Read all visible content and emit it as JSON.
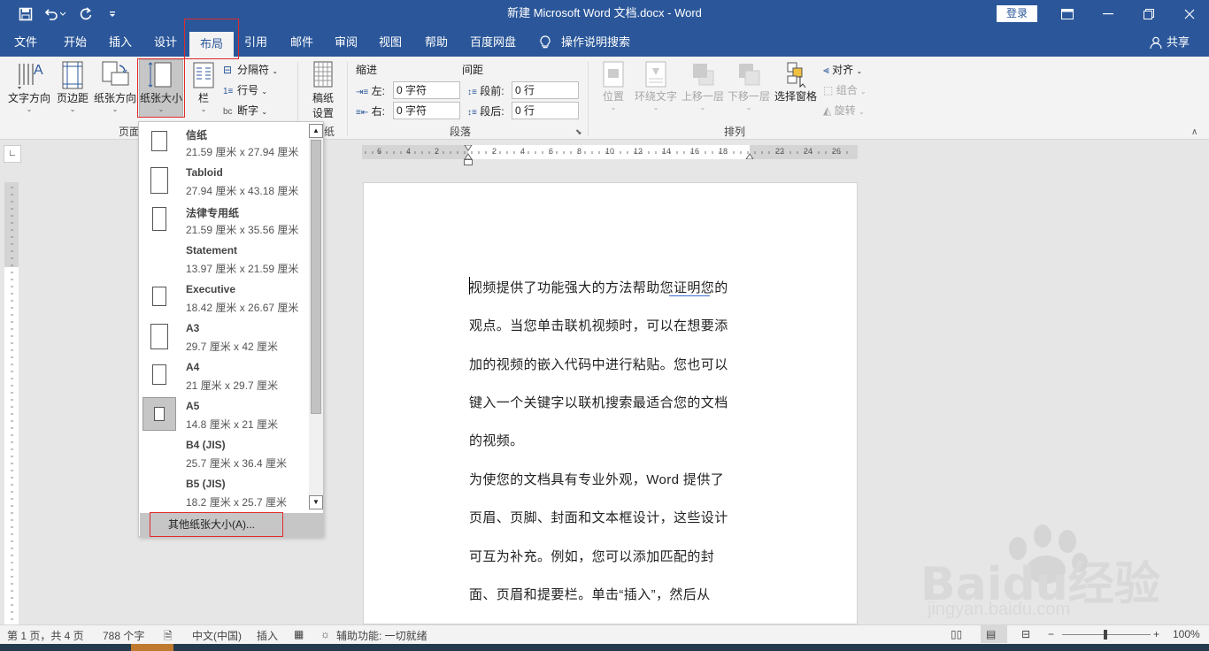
{
  "titlebar": {
    "title": "新建 Microsoft Word 文档.docx  -  Word",
    "login": "登录"
  },
  "tabs": [
    "文件",
    "开始",
    "插入",
    "设计",
    "布局",
    "引用",
    "邮件",
    "审阅",
    "视图",
    "帮助",
    "百度网盘"
  ],
  "tell_me": "操作说明搜索",
  "share": "共享",
  "ribbon": {
    "text_direction": "文字方向",
    "margins": "页边距",
    "orientation": "纸张方向",
    "size": "纸张大小",
    "columns": "栏",
    "breaks": "分隔符",
    "line_numbers": "行号",
    "hyphenation": "断字",
    "page_setup_group": "页面",
    "draft_line1": "稿纸",
    "draft_line2": "设置",
    "draft_group": "纸",
    "indent": "缩进",
    "spacing": "间距",
    "left_label": "左:",
    "right_label": "右:",
    "before_label": "段前:",
    "after_label": "段后:",
    "left_value": "0 字符",
    "right_value": "0 字符",
    "before_value": "0 行",
    "after_value": "0 行",
    "paragraph_group": "段落",
    "position": "位置",
    "wrap_text": "环绕文字",
    "bring_forward": "上移一层",
    "send_backward": "下移一层",
    "selection_pane": "选择窗格",
    "align": "对齐",
    "group": "组合",
    "rotate": "旋转",
    "arrange_group": "排列"
  },
  "ruler": {
    "labels": [
      "6",
      "4",
      "2",
      "2",
      "4",
      "6",
      "8",
      "10",
      "12",
      "14",
      "16",
      "18",
      "22",
      "24",
      "26"
    ]
  },
  "paper_sizes": [
    {
      "name": "信纸",
      "dims": "21.59 厘米 x 27.94 厘米"
    },
    {
      "name": "Tabloid",
      "dims": "27.94 厘米 x 43.18 厘米"
    },
    {
      "name": "法律专用纸",
      "dims": "21.59 厘米 x 35.56 厘米"
    },
    {
      "name": "Statement",
      "dims": "13.97 厘米 x 21.59 厘米"
    },
    {
      "name": "Executive",
      "dims": "18.42 厘米 x 26.67 厘米"
    },
    {
      "name": "A3",
      "dims": "29.7 厘米 x 42 厘米"
    },
    {
      "name": "A4",
      "dims": "21 厘米 x 29.7 厘米"
    },
    {
      "name": "A5",
      "dims": "14.8 厘米 x 21 厘米"
    },
    {
      "name": "B4 (JIS)",
      "dims": "25.7 厘米 x 36.4 厘米"
    },
    {
      "name": "B5 (JIS)",
      "dims": "18.2 厘米 x 25.7 厘米"
    }
  ],
  "more_sizes": "其他纸张大小(A)...",
  "document": {
    "lines": [
      "视频提供了功能强大的方法帮助您证明您的",
      "观点。当您单击联机视频时，可以在想要添",
      "加的视频的嵌入代码中进行粘贴。您也可以",
      "键入一个关键字以联机搜索最适合您的文档",
      "的视频。",
      "为使您的文档具有专业外观，Word 提供了",
      "页眉、页脚、封面和文本框设计，这些设计",
      "可互为补充。例如，您可以添加匹配的封",
      "面、页眉和提要栏。单击“插入”，然后从"
    ]
  },
  "statusbar": {
    "page": "第 1 页，共 4 页",
    "words": "788 个字",
    "language": "中文(中国)",
    "mode": "插入",
    "accessibility": "辅助功能: 一切就绪",
    "zoom": "100%"
  },
  "watermark": {
    "brand": "Baidu经验",
    "url": "jingyan.baidu.com"
  },
  "colors": {
    "brand": "#2b579a",
    "highlight": "#e02b2b"
  }
}
